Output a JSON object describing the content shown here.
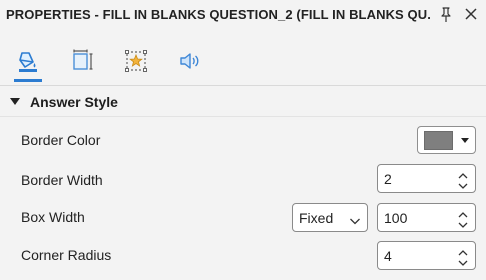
{
  "panel": {
    "title": "PROPERTIES - FILL IN BLANKS QUESTION_2 (FILL IN BLANKS QU...",
    "pin_icon": "pin-icon",
    "close_icon": "close-icon"
  },
  "tabs": [
    {
      "icon": "paint-bucket-icon",
      "active": true
    },
    {
      "icon": "size-position-icon",
      "active": false
    },
    {
      "icon": "star-effects-icon",
      "active": false
    },
    {
      "icon": "speaker-audio-icon",
      "active": false
    }
  ],
  "section": {
    "title": "Answer Style",
    "expanded": true
  },
  "properties": {
    "border_color": {
      "label": "Border Color",
      "value": "#7f7f7f"
    },
    "border_width": {
      "label": "Border Width",
      "value": "2"
    },
    "box_width": {
      "label": "Box Width",
      "mode": "Fixed",
      "value": "100"
    },
    "corner_radius": {
      "label": "Corner Radius",
      "value": "4"
    }
  },
  "colors": {
    "accent": "#2c7cd1",
    "background": "#f3f3f3"
  }
}
